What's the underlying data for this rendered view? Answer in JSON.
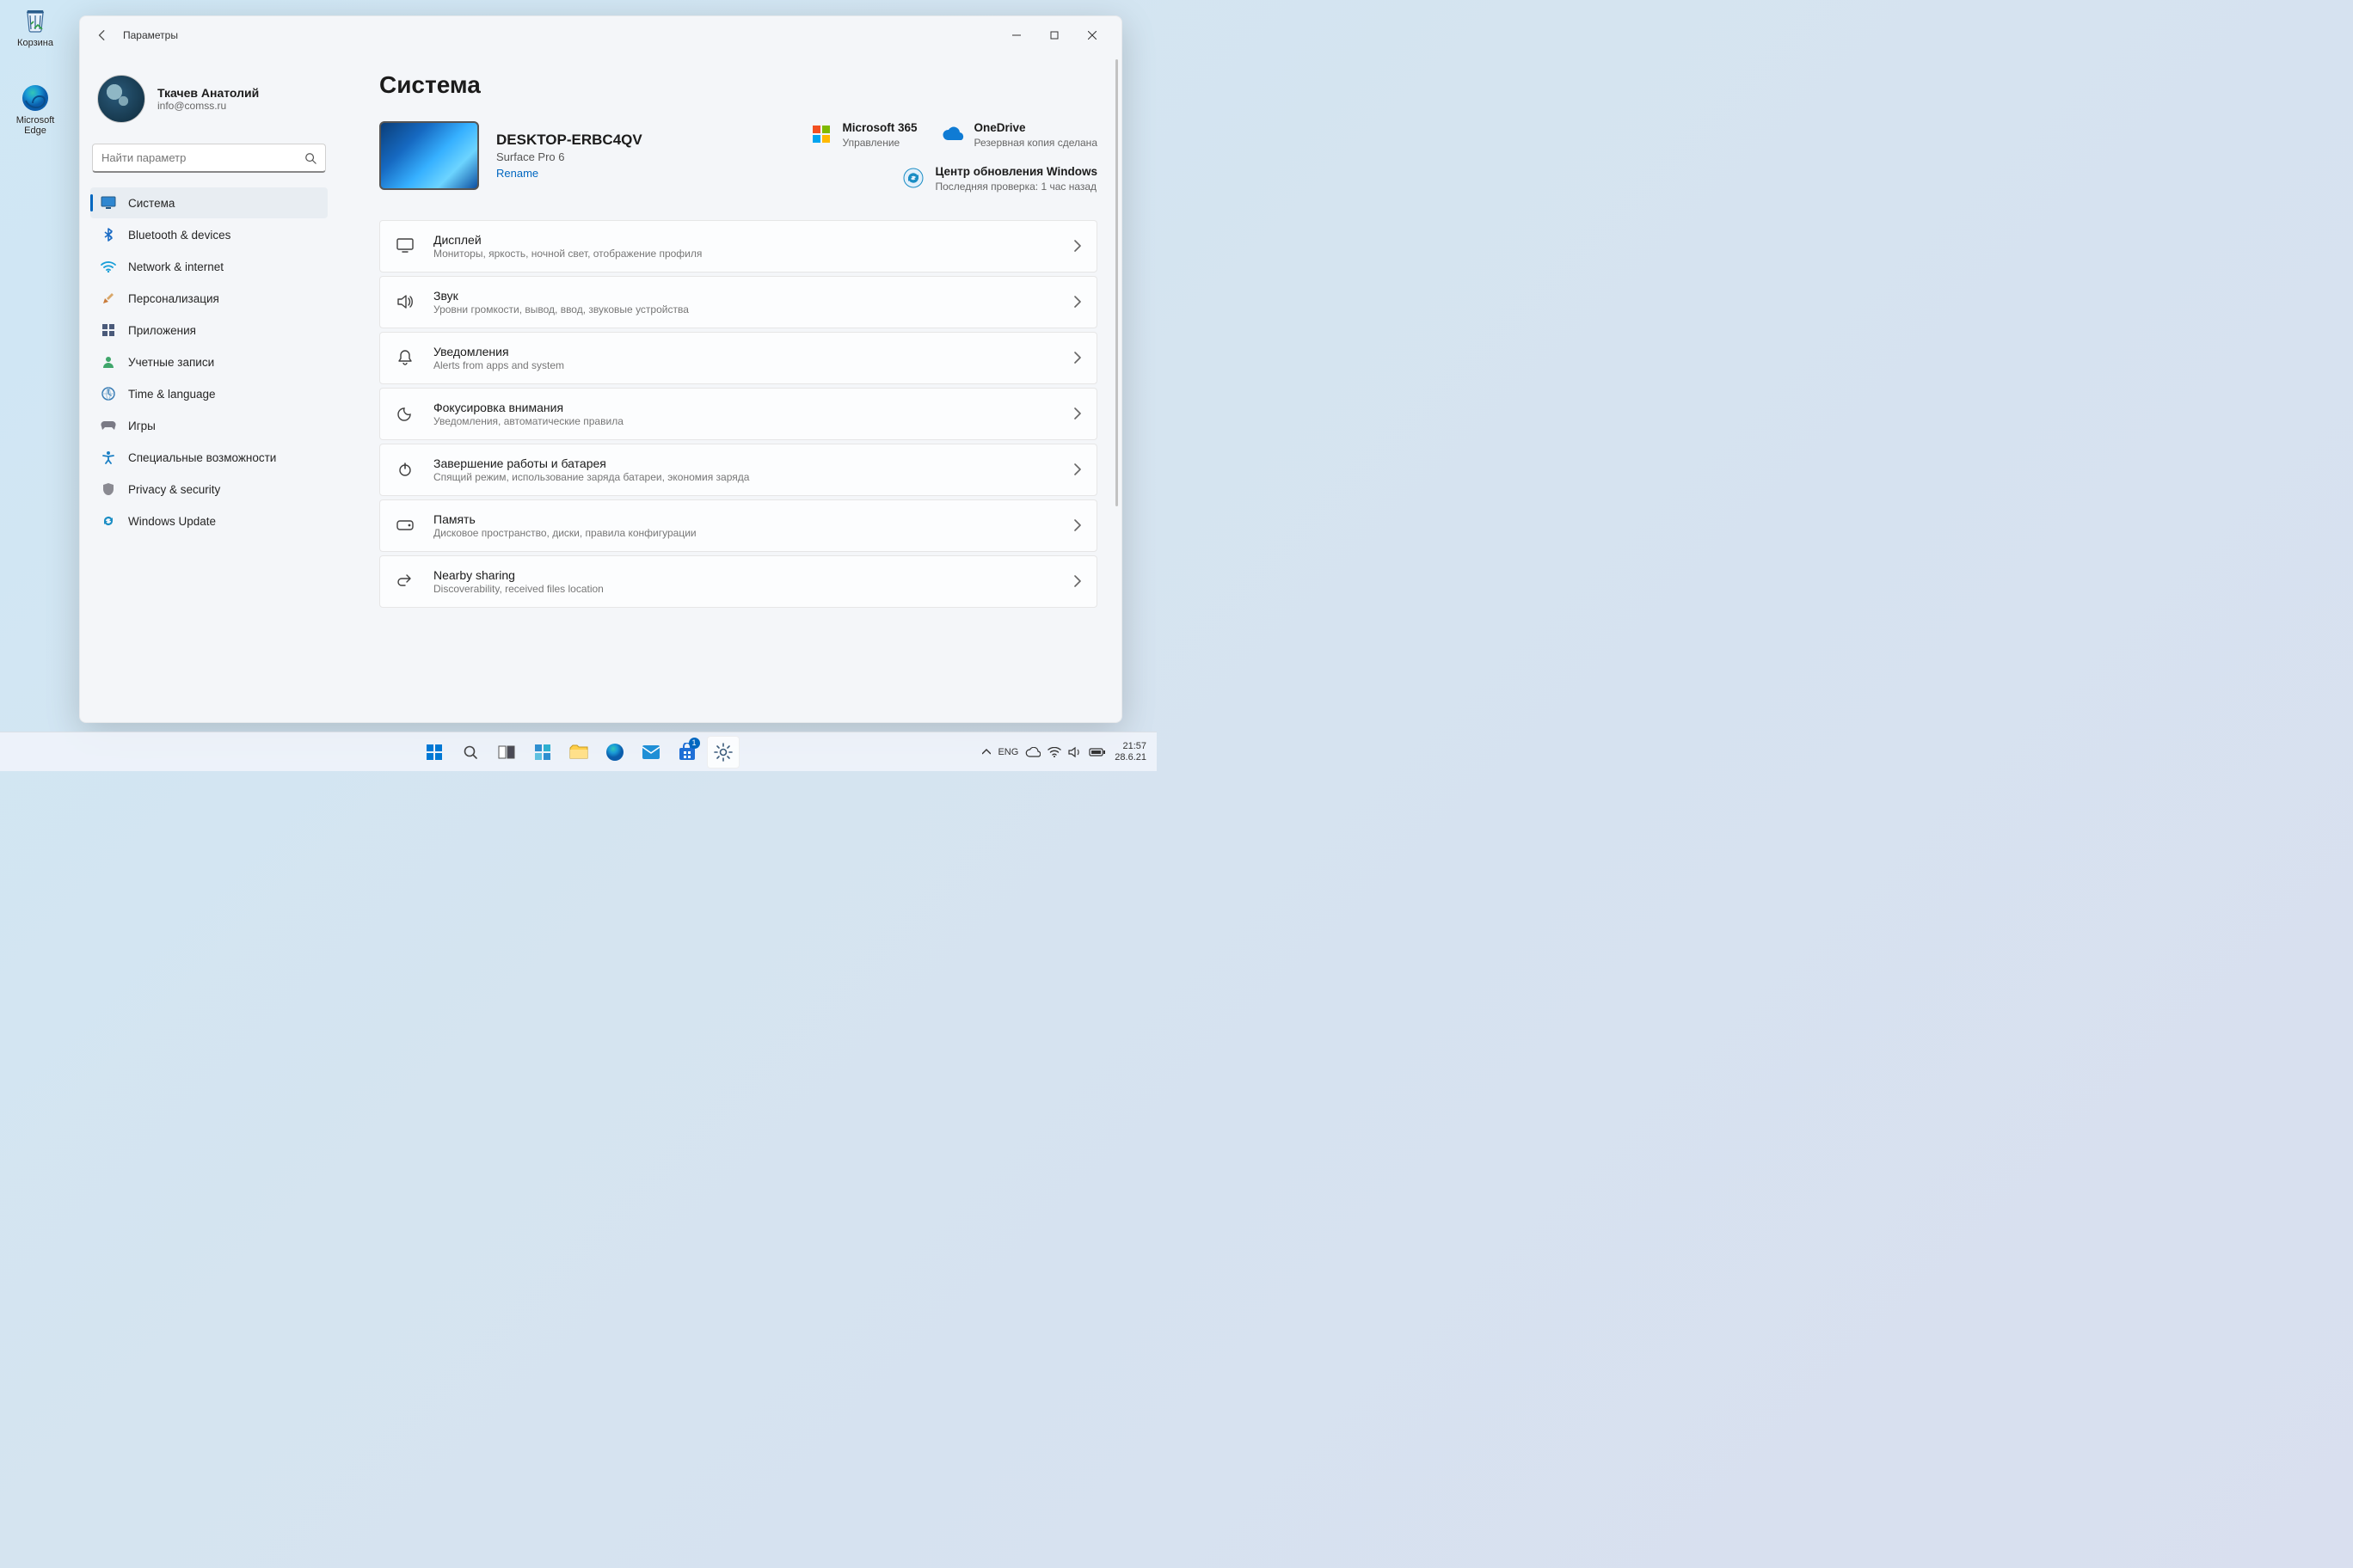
{
  "desktop": {
    "recycle_bin": "Корзина",
    "edge": "Microsoft Edge"
  },
  "window": {
    "title": "Параметры",
    "page_title": "Система"
  },
  "account": {
    "name": "Ткачев Анатолий",
    "email": "info@comss.ru"
  },
  "search": {
    "placeholder": "Найти параметр"
  },
  "sidebar": {
    "items": [
      {
        "label": "Система",
        "icon": "system-icon",
        "selected": true
      },
      {
        "label": "Bluetooth & devices",
        "icon": "bluetooth-icon"
      },
      {
        "label": "Network & internet",
        "icon": "network-icon"
      },
      {
        "label": "Персонализация",
        "icon": "personalization-icon"
      },
      {
        "label": "Приложения",
        "icon": "apps-icon"
      },
      {
        "label": "Учетные записи",
        "icon": "accounts-icon"
      },
      {
        "label": "Time & language",
        "icon": "time-language-icon"
      },
      {
        "label": "Игры",
        "icon": "gaming-icon"
      },
      {
        "label": "Специальные возможности",
        "icon": "accessibility-icon"
      },
      {
        "label": "Privacy & security",
        "icon": "privacy-icon"
      },
      {
        "label": "Windows Update",
        "icon": "update-icon"
      }
    ]
  },
  "device": {
    "name": "DESKTOP-ERBC4QV",
    "model": "Surface Pro 6",
    "rename": "Rename"
  },
  "status": {
    "ms365": {
      "title": "Microsoft 365",
      "sub": "Управление"
    },
    "onedrive": {
      "title": "OneDrive",
      "sub": "Резервная копия сделана"
    },
    "update": {
      "title": "Центр обновления Windows",
      "sub": "Последняя проверка: 1 час назад"
    }
  },
  "cards": [
    {
      "title": "Дисплей",
      "sub": "Мониторы, яркость, ночной свет, отображение профиля",
      "icon": "display-icon"
    },
    {
      "title": "Звук",
      "sub": "Уровни громкости, вывод, ввод, звуковые устройства",
      "icon": "sound-icon"
    },
    {
      "title": "Уведомления",
      "sub": "Alerts from apps and system",
      "icon": "notifications-icon"
    },
    {
      "title": "Фокусировка внимания",
      "sub": "Уведомления, автоматические правила",
      "icon": "focus-assist-icon"
    },
    {
      "title": "Завершение работы и батарея",
      "sub": "Спящий режим, использование заряда батареи, экономия заряда",
      "icon": "power-battery-icon"
    },
    {
      "title": "Память",
      "sub": "Дисковое пространство, диски, правила конфигурации",
      "icon": "storage-icon"
    },
    {
      "title": "Nearby sharing",
      "sub": "Discoverability, received files location",
      "icon": "nearby-sharing-icon"
    }
  ],
  "taskbar": {
    "store_badge": "1",
    "lang": "ENG",
    "time": "21:57",
    "date": "28.6.21"
  },
  "colors": {
    "accent": "#0067c0",
    "bg": "#f4f6f9",
    "border": "#e6e6e6"
  }
}
